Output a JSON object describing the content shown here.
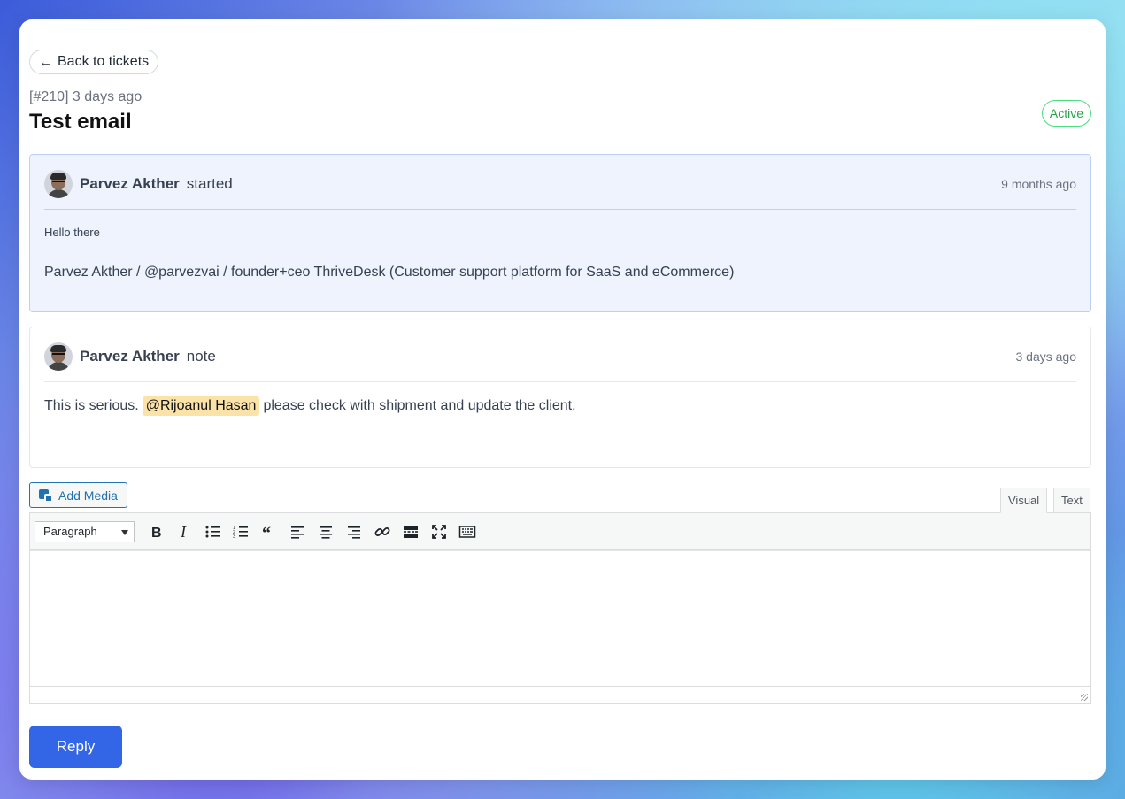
{
  "nav": {
    "back_label": "Back to tickets"
  },
  "ticket": {
    "meta": "[#210] 3 days ago",
    "title": "Test email",
    "status": "Active"
  },
  "messages": [
    {
      "author": "Parvez Akther",
      "action": "started",
      "time": "9 months ago",
      "lines": [
        "Hello there",
        "Parvez Akther / @parvezvai / founder+ceo ThriveDesk (Customer support platform for SaaS and eCommerce)"
      ]
    },
    {
      "author": "Parvez Akther",
      "action": "note",
      "time": "3 days ago",
      "text_before": "This is serious.",
      "mention": "@Rijoanul Hasan",
      "text_after": "please check with shipment and update the client."
    }
  ],
  "editor": {
    "add_media_label": "Add Media",
    "tab_visual": "Visual",
    "tab_text": "Text",
    "format_selected": "Paragraph",
    "toolbar_icons": [
      "bold-icon",
      "italic-icon",
      "bullet-list-icon",
      "numbered-list-icon",
      "blockquote-icon",
      "align-left-icon",
      "align-center-icon",
      "align-right-icon",
      "link-icon",
      "read-more-icon",
      "fullscreen-icon",
      "toolbar-toggle-icon"
    ]
  },
  "actions": {
    "reply_label": "Reply"
  },
  "colors": {
    "accent": "#3366e6",
    "status_green": "#22a34a",
    "mention_bg": "#fbe3a8"
  }
}
